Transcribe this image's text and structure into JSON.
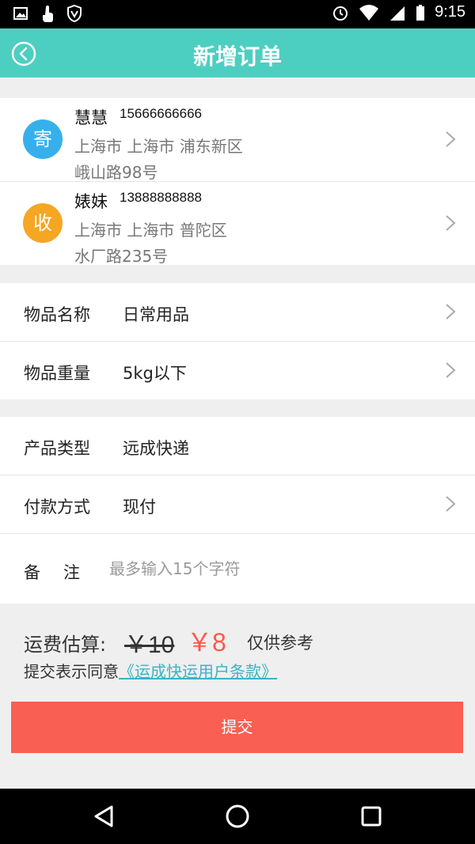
{
  "status_bar": {
    "left_icons": [
      "image-icon",
      "hand-touch-icon",
      "shield-vpn-icon"
    ],
    "right_icons": [
      "alarm-icon",
      "wifi-icon",
      "signal-icon",
      "battery-icon"
    ],
    "time": "9:15"
  },
  "header": {
    "title": "新增订单",
    "back_icon": "chevron-left-circle-icon"
  },
  "sender": {
    "badge": "寄",
    "name": "慧慧",
    "phone": "15666666666",
    "region": "上海市  上海市  浦东新区",
    "street": "峨山路98号",
    "badge_color": "#36b0ec"
  },
  "receiver": {
    "badge": "收",
    "name": "婊妹",
    "phone": "13888888888",
    "region": "上海市  上海市  普陀区",
    "street": "水厂路235号",
    "badge_color": "#f5a623"
  },
  "item": {
    "name_label": "物品名称",
    "name_value": "日常用品",
    "weight_label": "物品重量",
    "weight_value": "5kg以下"
  },
  "delivery": {
    "product_label": "产品类型",
    "product_value": "远成快递",
    "payment_label": "付款方式",
    "payment_value": "现付",
    "note_label_1": "备",
    "note_label_2": "注",
    "note_placeholder": "最多输入15个字符",
    "note_value": ""
  },
  "fee": {
    "label": "运费估算:",
    "original": "￥10",
    "price": "￥8",
    "hint": "仅供参考",
    "agree_text": "提交表示同意",
    "terms_link": "《运成快运用户条款》"
  },
  "submit_label": "提交",
  "colors": {
    "accent": "#4ccfc1",
    "price": "#fa5a4a",
    "submit": "#f95f52",
    "link": "#3ab3c7"
  },
  "nav_bar": [
    "back-triangle-icon",
    "home-circle-icon",
    "recents-square-icon"
  ]
}
